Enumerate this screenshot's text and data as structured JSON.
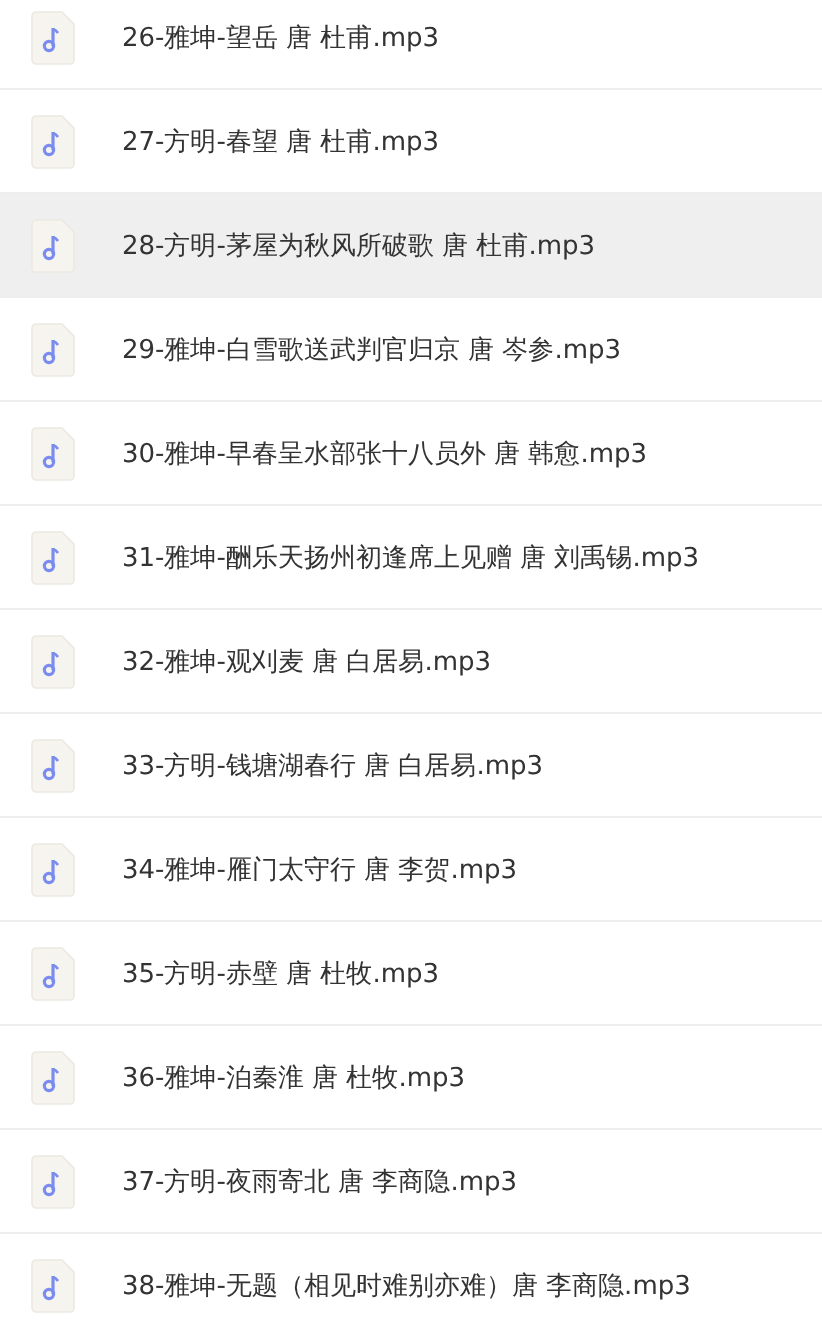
{
  "files": [
    {
      "name": "26-雅坤-望岳 唐 杜甫.mp3",
      "selected": false
    },
    {
      "name": "27-方明-春望 唐 杜甫.mp3",
      "selected": false
    },
    {
      "name": "28-方明-茅屋为秋风所破歌 唐 杜甫.mp3",
      "selected": true
    },
    {
      "name": "29-雅坤-白雪歌送武判官归京 唐 岑参.mp3",
      "selected": false
    },
    {
      "name": "30-雅坤-早春呈水部张十八员外 唐 韩愈.mp3",
      "selected": false
    },
    {
      "name": "31-雅坤-酬乐天扬州初逢席上见赠 唐 刘禹锡.mp3",
      "selected": false
    },
    {
      "name": "32-雅坤-观刈麦 唐 白居易.mp3",
      "selected": false
    },
    {
      "name": "33-方明-钱塘湖春行 唐 白居易.mp3",
      "selected": false
    },
    {
      "name": "34-雅坤-雁门太守行 唐 李贺.mp3",
      "selected": false
    },
    {
      "name": "35-方明-赤壁 唐 杜牧.mp3",
      "selected": false
    },
    {
      "name": "36-雅坤-泊秦淮 唐 杜牧.mp3",
      "selected": false
    },
    {
      "name": "37-方明-夜雨寄北 唐 李商隐.mp3",
      "selected": false
    },
    {
      "name": "38-雅坤-无题（相见时难别亦难）唐 李商隐.mp3",
      "selected": false
    }
  ]
}
